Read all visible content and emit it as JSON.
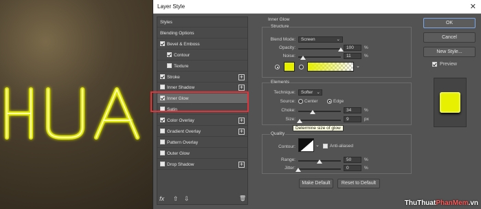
{
  "canvas": {
    "neon_text": "HUA"
  },
  "dialog": {
    "title": "Layer Style",
    "close_glyph": "✕"
  },
  "styles_panel": {
    "items": [
      {
        "label": "Styles",
        "checkbox": false,
        "checked": false,
        "plus": false,
        "indent": false
      },
      {
        "label": "Blending Options",
        "checkbox": false,
        "checked": false,
        "plus": false,
        "indent": false
      },
      {
        "label": "Bevel & Emboss",
        "checkbox": true,
        "checked": true,
        "plus": false,
        "indent": false
      },
      {
        "label": "Contour",
        "checkbox": true,
        "checked": true,
        "plus": false,
        "indent": true
      },
      {
        "label": "Texture",
        "checkbox": true,
        "checked": false,
        "plus": false,
        "indent": true
      },
      {
        "label": "Stroke",
        "checkbox": true,
        "checked": true,
        "plus": true,
        "indent": false
      },
      {
        "label": "Inner Shadow",
        "checkbox": true,
        "checked": false,
        "plus": true,
        "indent": false
      },
      {
        "label": "Inner Glow",
        "checkbox": true,
        "checked": true,
        "plus": false,
        "indent": false,
        "selected": true
      },
      {
        "label": "Satin",
        "checkbox": true,
        "checked": false,
        "plus": false,
        "indent": false
      },
      {
        "label": "Color Overlay",
        "checkbox": true,
        "checked": true,
        "plus": true,
        "indent": false
      },
      {
        "label": "Gradient Overlay",
        "checkbox": true,
        "checked": false,
        "plus": true,
        "indent": false
      },
      {
        "label": "Pattern Overlay",
        "checkbox": true,
        "checked": false,
        "plus": false,
        "indent": false
      },
      {
        "label": "Outer Glow",
        "checkbox": true,
        "checked": false,
        "plus": false,
        "indent": false
      },
      {
        "label": "Drop Shadow",
        "checkbox": true,
        "checked": false,
        "plus": true,
        "indent": false
      }
    ],
    "bottom": {
      "fx": "fx",
      "up": "⇧",
      "down": "⇩",
      "trash": "🗑"
    }
  },
  "inner_glow": {
    "section_title": "Inner Glow",
    "structure": {
      "title": "Structure",
      "blend_mode_label": "Blend Mode:",
      "blend_mode_value": "Screen",
      "opacity_label": "Opacity:",
      "opacity_value": "100",
      "opacity_fraction": 1.0,
      "noise_label": "Noise:",
      "noise_value": "11",
      "noise_fraction": 0.11,
      "percent": "%",
      "glow_color": "#e6f000"
    },
    "elements": {
      "title": "Elements",
      "technique_label": "Technique:",
      "technique_value": "Softer",
      "source_label": "Source:",
      "source_center": "Center",
      "source_edge": "Edge",
      "choke_label": "Choke:",
      "choke_value": "34",
      "choke_fraction": 0.34,
      "size_label": "Size:",
      "size_value": "9",
      "size_fraction": 0.04,
      "px": "px",
      "tooltip": "Determine size of glow"
    },
    "quality": {
      "title": "Quality",
      "contour_label": "Contour:",
      "anti_aliased_label": "Anti-aliased",
      "range_label": "Range:",
      "range_value": "50",
      "range_fraction": 0.5,
      "jitter_label": "Jitter:",
      "jitter_value": "0",
      "jitter_fraction": 0.0
    },
    "make_default": "Make Default",
    "reset_default": "Reset to Default"
  },
  "right_buttons": {
    "ok": "OK",
    "cancel": "Cancel",
    "new_style": "New Style...",
    "preview": "Preview"
  },
  "preview_color": "#e6f000",
  "watermark": {
    "part1": "ThuThuat",
    "part2": "PhanMem",
    "part3": ".vn"
  }
}
